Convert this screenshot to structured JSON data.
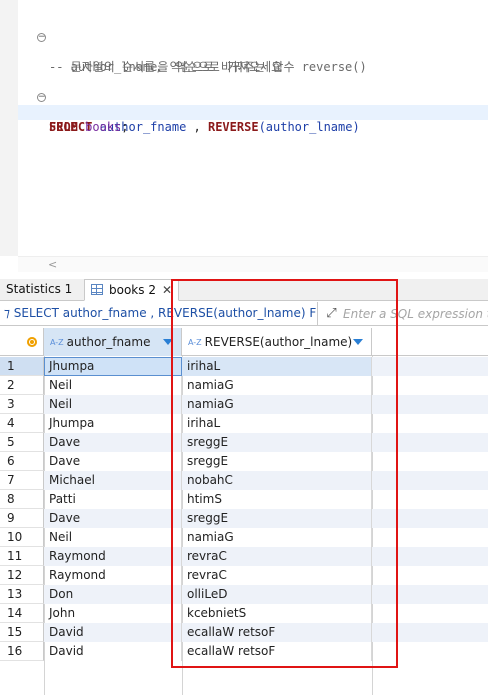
{
  "editor": {
    "lines": [
      {
        "type": "comment",
        "fold": true,
        "text": "-- 문자열의 순서를, 역순으로 바꿔주는 함수 reverse()"
      },
      {
        "type": "comment",
        "fold": false,
        "text": "-- author_lname을 역순으로 가져오세요"
      },
      {
        "type": "sql1"
      },
      {
        "type": "sql2"
      }
    ],
    "sql": {
      "select_kw": "SELECT",
      "col1": "author_fname",
      "sep": " , ",
      "func": "REVERSE",
      "arg": "(author_lname)",
      "from_kw": "FROM",
      "table": "books",
      "semi": ";"
    },
    "fold_symbol": "−"
  },
  "tabs": [
    {
      "label": "Statistics 1",
      "active": false
    },
    {
      "label": "books 2",
      "active": true,
      "close": "✕"
    }
  ],
  "filterbar": {
    "query": "⁊ SELECT author_fname , REVERSE(author_lname) FROM bo",
    "expand_icon": "⤢",
    "placeholder": "Enter a SQL expression to filter results (use Ctrl+Space)"
  },
  "grid": {
    "columns": [
      {
        "label": "author_fname",
        "type_icon": "A-Z"
      },
      {
        "label": "REVERSE(author_lname)",
        "type_icon": "A-Z"
      }
    ],
    "rows": [
      [
        "1",
        "Jhumpa",
        "irihaL"
      ],
      [
        "2",
        "Neil",
        "namiaG"
      ],
      [
        "3",
        "Neil",
        "namiaG"
      ],
      [
        "4",
        "Jhumpa",
        "irihaL"
      ],
      [
        "5",
        "Dave",
        "sreggE"
      ],
      [
        "6",
        "Dave",
        "sreggE"
      ],
      [
        "7",
        "Michael",
        "nobahC"
      ],
      [
        "8",
        "Patti",
        "htimS"
      ],
      [
        "9",
        "Dave",
        "sreggE"
      ],
      [
        "10",
        "Neil",
        "namiaG"
      ],
      [
        "11",
        "Raymond",
        "revraC"
      ],
      [
        "12",
        "Raymond",
        "revraC"
      ],
      [
        "13",
        "Don",
        "olliLeD"
      ],
      [
        "14",
        "John",
        "kcebnietS"
      ],
      [
        "15",
        "David",
        "ecallaW retsoF"
      ],
      [
        "16",
        "David",
        "ecallaW retsoF"
      ]
    ]
  },
  "colors": {
    "highlight": "#e01414",
    "keyword": "#8b1a1a",
    "identifier": "#1e3fa8",
    "table": "#7a2ea0",
    "comment": "#6a6a6a"
  }
}
